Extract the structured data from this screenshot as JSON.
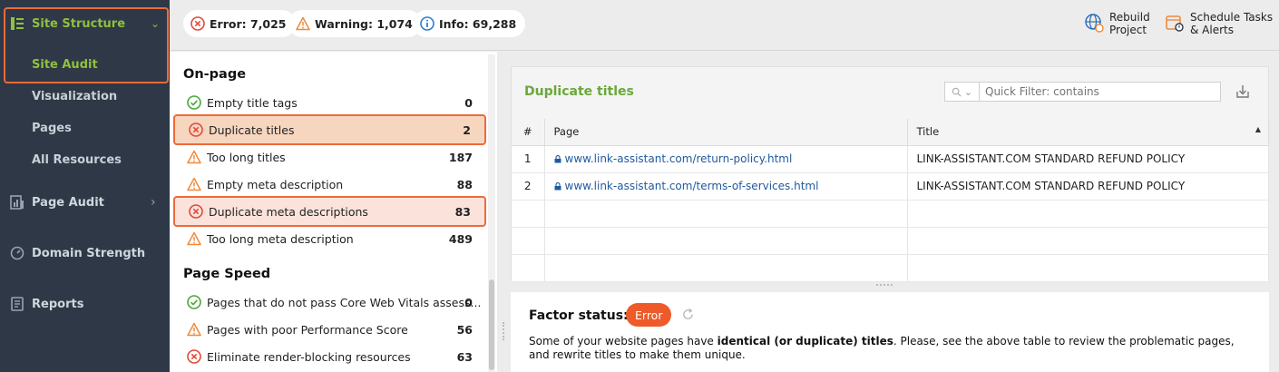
{
  "sidebar": {
    "site_structure": "Site Structure",
    "site_audit": "Site Audit",
    "visualization": "Visualization",
    "pages": "Pages",
    "all_resources": "All Resources",
    "page_audit": "Page Audit",
    "domain_strength": "Domain Strength",
    "reports": "Reports"
  },
  "topbar": {
    "error": "Error: 7,025",
    "warning": "Warning: 1,074",
    "info": "Info: 69,288",
    "rebuild_l1": "Rebuild",
    "rebuild_l2": "Project",
    "schedule_l1": "Schedule Tasks",
    "schedule_l2": "& Alerts"
  },
  "onpage": {
    "title": "On-page",
    "items": [
      {
        "label": "Empty title tags",
        "count": "0",
        "status": "ok"
      },
      {
        "label": "Duplicate titles",
        "count": "2",
        "status": "error"
      },
      {
        "label": "Too long titles",
        "count": "187",
        "status": "warning"
      },
      {
        "label": "Empty meta description",
        "count": "88",
        "status": "warning"
      },
      {
        "label": "Duplicate meta descriptions",
        "count": "83",
        "status": "error"
      },
      {
        "label": "Too long meta description",
        "count": "489",
        "status": "warning"
      }
    ]
  },
  "pagespeed": {
    "title": "Page Speed",
    "items": [
      {
        "label": "Pages that do not pass Core Web Vitals assess...",
        "count": "0",
        "status": "ok"
      },
      {
        "label": "Pages with poor Performance Score",
        "count": "56",
        "status": "warning"
      },
      {
        "label": "Eliminate render-blocking resources",
        "count": "63",
        "status": "error"
      }
    ]
  },
  "panel": {
    "title": "Duplicate titles",
    "filter_placeholder": "Quick Filter: contains",
    "columns": {
      "num": "#",
      "page": "Page",
      "title": "Title"
    },
    "rows": [
      {
        "num": "1",
        "page": "www.link-assistant.com/return-policy.html",
        "title": "LINK-ASSISTANT.COM STANDARD REFUND POLICY"
      },
      {
        "num": "2",
        "page": "www.link-assistant.com/terms-of-services.html",
        "title": "LINK-ASSISTANT.COM STANDARD REFUND POLICY"
      }
    ]
  },
  "factor": {
    "label": "Factor status:",
    "status": "Error",
    "desc_pre": "Some of your website pages have ",
    "desc_bold": "identical (or duplicate) titles",
    "desc_post": ". Please, see the above table to review the problematic pages, and rewrite titles to make them unique."
  },
  "colors": {
    "sidebar_bg": "#2e3846",
    "accent_green": "#8fc13d",
    "highlight_orange": "#ee6a3a",
    "error_red": "#e04a3a",
    "warning_orange": "#f08a3a",
    "ok_green": "#4aa83a",
    "link_blue": "#1f5a9e"
  }
}
